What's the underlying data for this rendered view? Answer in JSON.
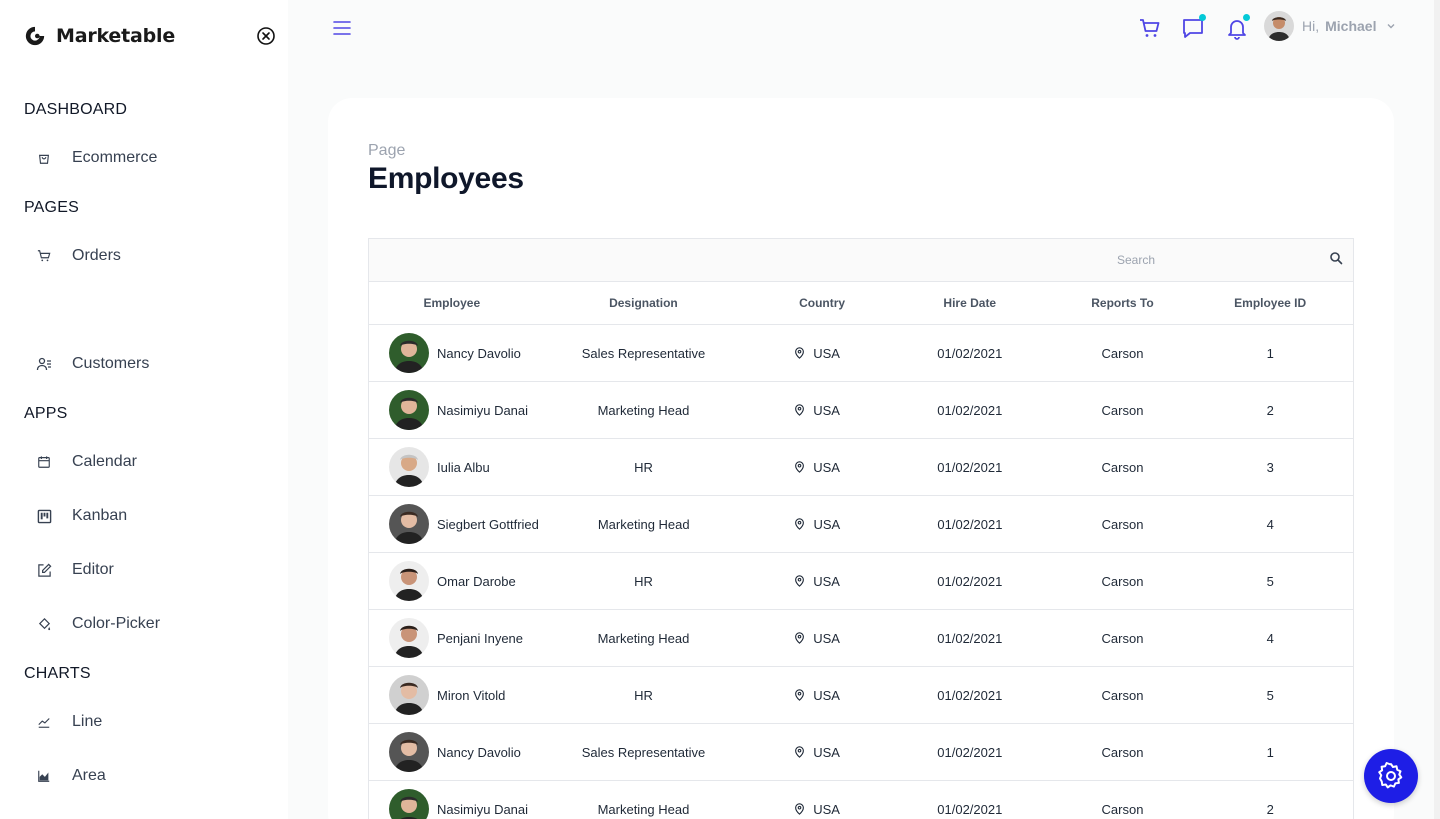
{
  "app": {
    "brand": "Marketable"
  },
  "sidebar": {
    "sections": [
      {
        "title": "DASHBOARD",
        "items": [
          {
            "label": "Ecommerce",
            "icon": "shopping-bag-icon"
          }
        ]
      },
      {
        "title": "PAGES",
        "items": [
          {
            "label": "Orders",
            "icon": "cart-icon"
          },
          {
            "label": "Customers",
            "icon": "users-icon"
          }
        ]
      },
      {
        "title": "APPS",
        "items": [
          {
            "label": "Calendar",
            "icon": "calendar-icon"
          },
          {
            "label": "Kanban",
            "icon": "kanban-icon"
          },
          {
            "label": "Editor",
            "icon": "edit-icon"
          },
          {
            "label": "Color-Picker",
            "icon": "paint-bucket-icon"
          }
        ]
      },
      {
        "title": "CHARTS",
        "items": [
          {
            "label": "Line",
            "icon": "line-chart-icon"
          },
          {
            "label": "Area",
            "icon": "area-chart-icon"
          }
        ]
      }
    ]
  },
  "header": {
    "greeting": "Hi,",
    "user_name": "Michael",
    "accent": "#4f46e5",
    "badge_color": "#03c9d7"
  },
  "page": {
    "breadcrumb": "Page",
    "title": "Employees"
  },
  "grid": {
    "search_placeholder": "Search",
    "columns": [
      "Employee",
      "Designation",
      "Country",
      "Hire Date",
      "Reports To",
      "Employee ID"
    ],
    "rows": [
      {
        "name": "Nancy Davolio",
        "designation": "Sales Representative",
        "country": "USA",
        "hire_date": "01/02/2021",
        "reports_to": "Carson",
        "id": "1"
      },
      {
        "name": "Nasimiyu Danai",
        "designation": "Marketing Head",
        "country": "USA",
        "hire_date": "01/02/2021",
        "reports_to": "Carson",
        "id": "2"
      },
      {
        "name": "Iulia Albu",
        "designation": "HR",
        "country": "USA",
        "hire_date": "01/02/2021",
        "reports_to": "Carson",
        "id": "3"
      },
      {
        "name": "Siegbert Gottfried",
        "designation": "Marketing Head",
        "country": "USA",
        "hire_date": "01/02/2021",
        "reports_to": "Carson",
        "id": "4"
      },
      {
        "name": "Omar Darobe",
        "designation": "HR",
        "country": "USA",
        "hire_date": "01/02/2021",
        "reports_to": "Carson",
        "id": "5"
      },
      {
        "name": "Penjani Inyene",
        "designation": "Marketing Head",
        "country": "USA",
        "hire_date": "01/02/2021",
        "reports_to": "Carson",
        "id": "4"
      },
      {
        "name": "Miron Vitold",
        "designation": "HR",
        "country": "USA",
        "hire_date": "01/02/2021",
        "reports_to": "Carson",
        "id": "5"
      },
      {
        "name": "Nancy Davolio",
        "designation": "Sales Representative",
        "country": "USA",
        "hire_date": "01/02/2021",
        "reports_to": "Carson",
        "id": "1"
      },
      {
        "name": "Nasimiyu Danai",
        "designation": "Marketing Head",
        "country": "USA",
        "hire_date": "01/02/2021",
        "reports_to": "Carson",
        "id": "2"
      }
    ]
  },
  "settings_button": {
    "icon": "gear-icon",
    "color": "#1e1ee6"
  }
}
